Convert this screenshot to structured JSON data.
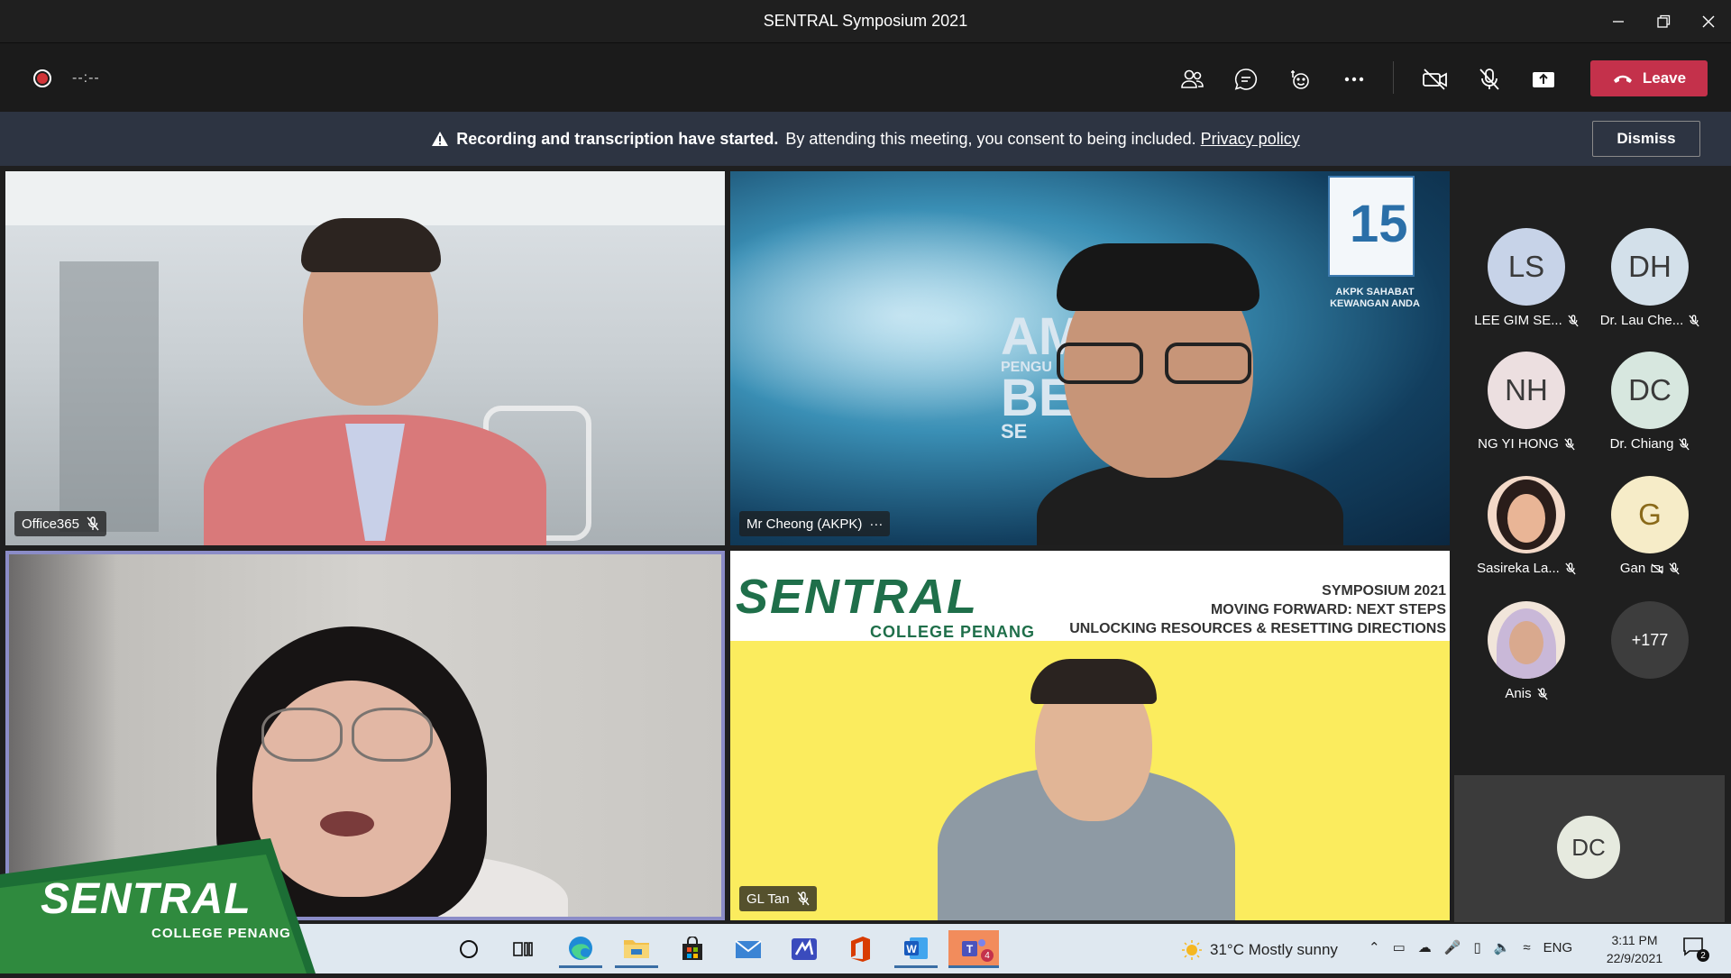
{
  "window": {
    "title": "SENTRAL Symposium 2021"
  },
  "toolbar": {
    "timer": "--:--",
    "leave_label": "Leave"
  },
  "banner": {
    "strong": "Recording and transcription have started.",
    "text": "By attending this meeting, you consent to being included.",
    "link": "Privacy policy",
    "dismiss": "Dismiss"
  },
  "tiles": [
    {
      "name": "Office365"
    },
    {
      "name": "Mr Cheong (AKPK)",
      "more": "···"
    },
    {
      "name": ""
    },
    {
      "name": "GL Tan"
    }
  ],
  "tile2_overlay": {
    "badge_lines": [
      "AKPK SAHABAT",
      "KEWANGAN ANDA"
    ],
    "bg_text": [
      "AM",
      "PENGU",
      "BE",
      "SE"
    ]
  },
  "tile4_banner": {
    "brand": "SENTRAL",
    "sub": "COLLEGE PENANG",
    "line1": "SYMPOSIUM 2021",
    "line2": "MOVING FORWARD: NEXT STEPS",
    "line3": "UNLOCKING RESOURCES & RESETTING DIRECTIONS"
  },
  "roster": [
    {
      "initials": "LS",
      "name": "LEE GIM SE...",
      "color": "#c7d3e8"
    },
    {
      "initials": "DH",
      "name": "Dr. Lau Che...",
      "color": "#d3e0ea"
    },
    {
      "initials": "NH",
      "name": "NG YI HONG",
      "color": "#ecdfe0"
    },
    {
      "initials": "DC",
      "name": "Dr. Chiang",
      "color": "#d7e7df"
    },
    {
      "initials": "",
      "name": "Sasireka La...",
      "color": "#f3d9c8"
    },
    {
      "initials": "G",
      "name": "Gan",
      "color": "#f6ecc8"
    },
    {
      "initials": "",
      "name": "Anis",
      "color": "#f1e5da"
    },
    {
      "initials": "+177",
      "name": "",
      "color": "#3d3d3d"
    }
  ],
  "self_view": {
    "initials": "DC"
  },
  "college_logo": {
    "brand": "SENTRAL",
    "sub": "COLLEGE PENANG"
  },
  "taskbar": {
    "weather": "31°C  Mostly sunny",
    "lang": "ENG",
    "time": "3:11 PM",
    "date": "22/9/2021",
    "teams_badge": "4",
    "notif_badge": "2"
  }
}
